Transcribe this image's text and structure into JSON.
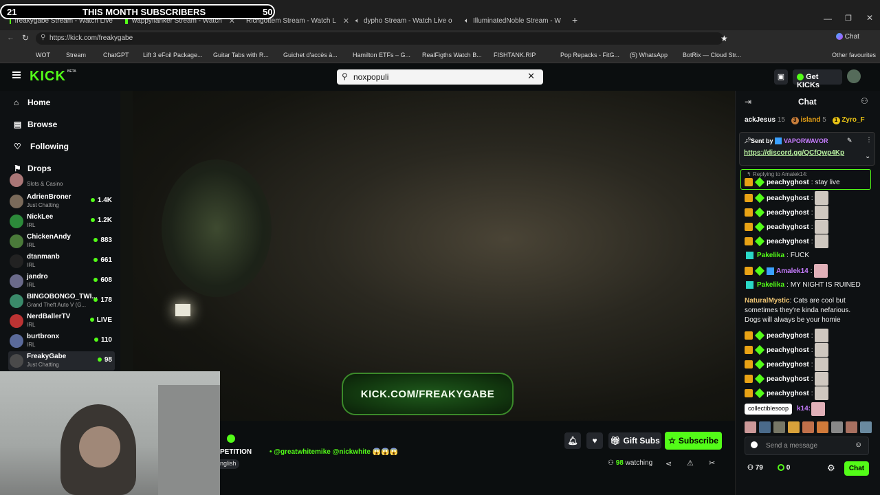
{
  "overlay": {
    "left_num": "21",
    "title": "THIS MONTH SUBSCRIBERS",
    "right_num": "50"
  },
  "browser": {
    "tabs": [
      {
        "label": "freakygabe Stream - Watch Live"
      },
      {
        "label": "wappyflanker Stream - Watch"
      },
      {
        "label": "Richgottem Stream - Watch L"
      },
      {
        "label": "dypho Stream - Watch Live o"
      },
      {
        "label": "IlluminatedNoble Stream - W"
      }
    ],
    "url": "https://kick.com/freakygabe",
    "bookmarks": [
      "WOT",
      "Stream",
      "ChatGPT",
      "Lift 3 eFoil Package...",
      "Guitar Tabs with R...",
      "Guichet d'accès à...",
      "Hamilton ETFs – G...",
      "RealFigths Watch B...",
      "FISHTANK.RIP",
      "Pop Repacks - FitG...",
      "(5) WhatsApp",
      "BotRix — Cloud Str...",
      "Other favourites"
    ],
    "profile_chat_label": "Chat"
  },
  "header": {
    "logo": "KICK",
    "logo_badge": "BETA",
    "search_value": "noxpopuli",
    "get_kicks_label": "Get KICKs"
  },
  "sidebar": {
    "nav": [
      {
        "label": "Home"
      },
      {
        "label": "Browse"
      },
      {
        "label": "Following"
      },
      {
        "label": "Drops"
      }
    ],
    "channels": [
      {
        "name": "",
        "category": "Slots & Casino",
        "viewers": ""
      },
      {
        "name": "AdrienBroner",
        "category": "Just Chatting",
        "viewers": "1.4K"
      },
      {
        "name": "NickLee",
        "category": "IRL",
        "viewers": "1.2K"
      },
      {
        "name": "ChickenAndy",
        "category": "IRL",
        "viewers": "883"
      },
      {
        "name": "dtanmanb",
        "category": "IRL",
        "viewers": "661"
      },
      {
        "name": "jandro",
        "category": "IRL",
        "viewers": "608"
      },
      {
        "name": "BINGOBONGO_TWI...",
        "category": "Grand Theft Auto V (G...",
        "viewers": "178"
      },
      {
        "name": "NerdBallerTV",
        "category": "IRL",
        "viewers": "LIVE"
      },
      {
        "name": "burtbronx",
        "category": "IRL",
        "viewers": "110"
      },
      {
        "name": "FreakyGabe",
        "category": "Just Chatting",
        "viewers": "98"
      }
    ]
  },
  "video": {
    "banner": "KICK.COM/FREAKYGABE"
  },
  "stream_info": {
    "title_fragment": "PETITION",
    "mentions": "• @greatwhitemike @nickwhite 😱😱😱",
    "language_tag": "nglish",
    "gift_subs_label": "Gift Subs",
    "subscribe_label": "Subscribe",
    "viewers_count": "98",
    "viewers_label": "watching"
  },
  "chat": {
    "title": "Chat",
    "leaderboard": [
      {
        "name": "ackJesus",
        "count": "15"
      },
      {
        "rank": "3",
        "name": "island",
        "count": "5"
      },
      {
        "rank": "1",
        "name": "Zyro_F"
      }
    ],
    "pinned": {
      "sent_by_label": "Sent by",
      "sender": "VAPORWAVOR",
      "link": "https://discord.gg/QCfQwp4Kp"
    },
    "reply_to": "Replying to Amalek14:",
    "messages": [
      {
        "user": "peachyghost",
        "text": "stay live"
      },
      {
        "user": "peachyghost",
        "text": ""
      },
      {
        "user": "peachyghost",
        "text": ""
      },
      {
        "user": "peachyghost",
        "text": ""
      },
      {
        "user": "peachyghost",
        "text": ""
      },
      {
        "user": "Pakelika",
        "text": "FUCK"
      },
      {
        "user": "Amalek14",
        "text": ""
      },
      {
        "user": "Pakelika",
        "text": "MY NIGHT IS RUINED"
      },
      {
        "user": "NaturalMystic",
        "text": "Cats are cool but",
        "text2": "sometimes they're kinda nefarious.",
        "text3": "Dogs will always be your homie"
      },
      {
        "user": "peachyghost",
        "text": ""
      },
      {
        "user": "peachyghost",
        "text": ""
      },
      {
        "user": "peachyghost",
        "text": ""
      },
      {
        "user": "peachyghost",
        "text": ""
      },
      {
        "user": "peachyghost",
        "text": ""
      }
    ],
    "tooltip": "collectiblesoop",
    "tooltip_tail_user": "k14:",
    "input_placeholder": "Send a message",
    "points": "79",
    "kicks": "0",
    "send_label": "Chat"
  },
  "colors": {
    "kick_green": "#53fc18",
    "bg": "#0b0e0f",
    "sidebar_bg": "#0e1113"
  }
}
